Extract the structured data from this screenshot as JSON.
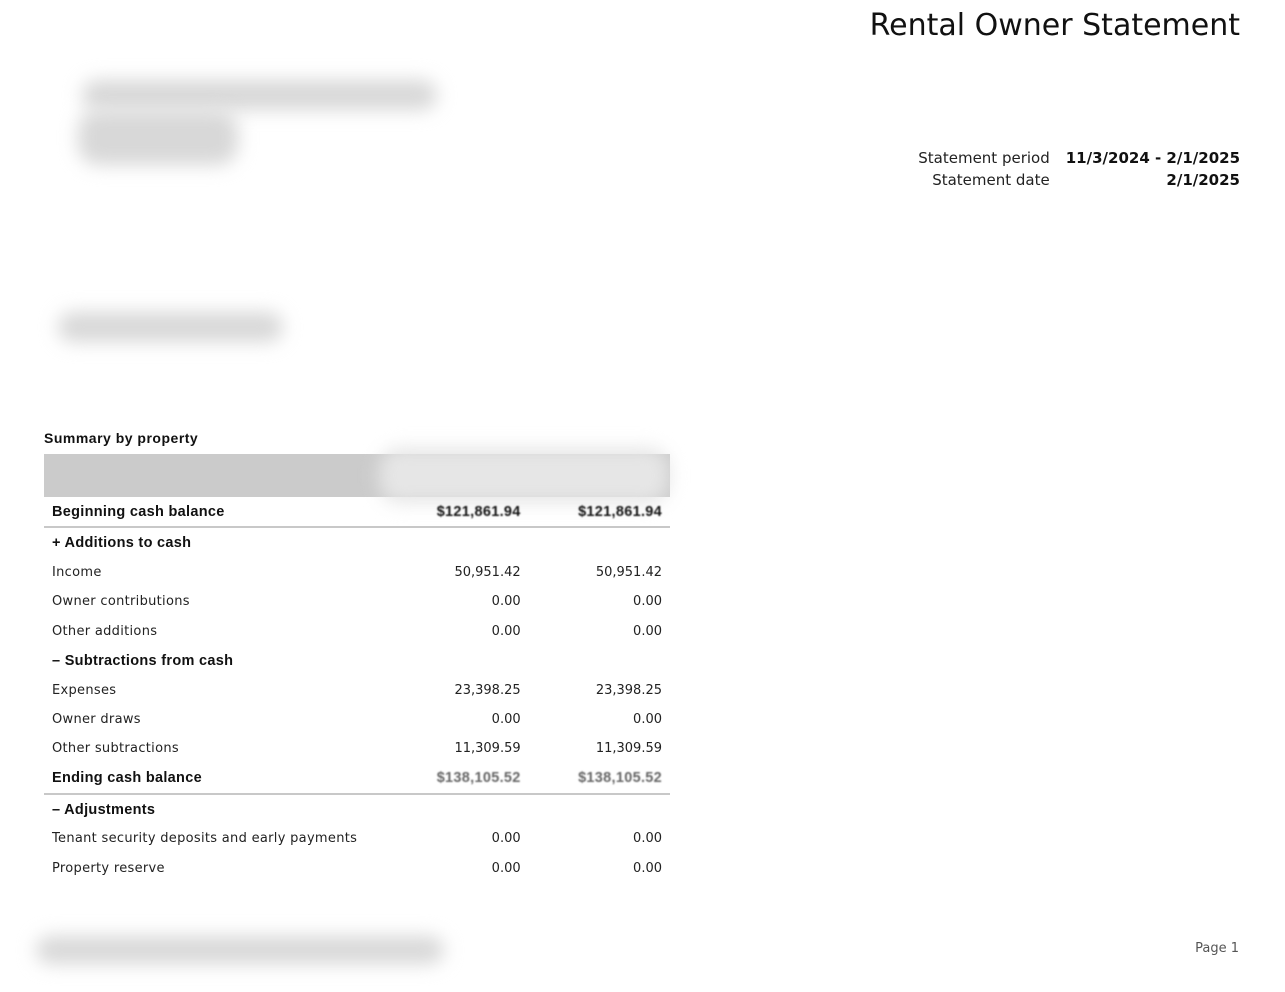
{
  "header": {
    "title": "Rental Owner Statement",
    "statement_period_label": "Statement period",
    "statement_period_value": "11/3/2024 - 2/1/2025",
    "statement_date_label": "Statement date",
    "statement_date_value": "2/1/2025"
  },
  "summary": {
    "title": "Summary by property",
    "rows": [
      {
        "label": "Beginning cash balance",
        "col1": "$121,861.94",
        "col2": "$121,861.94"
      },
      {
        "label": "+ Additions to cash",
        "col1": "",
        "col2": ""
      },
      {
        "label": "Income",
        "col1": "50,951.42",
        "col2": "50,951.42"
      },
      {
        "label": "Owner contributions",
        "col1": "0.00",
        "col2": "0.00"
      },
      {
        "label": "Other additions",
        "col1": "0.00",
        "col2": "0.00"
      },
      {
        "label": "– Subtractions from cash",
        "col1": "",
        "col2": ""
      },
      {
        "label": "Expenses",
        "col1": "23,398.25",
        "col2": "23,398.25"
      },
      {
        "label": "Owner draws",
        "col1": "0.00",
        "col2": "0.00"
      },
      {
        "label": "Other subtractions",
        "col1": "11,309.59",
        "col2": "11,309.59"
      },
      {
        "label": "Ending cash balance",
        "col1": "$138,105.52",
        "col2": "$138,105.52"
      },
      {
        "label": "– Adjustments",
        "col1": "",
        "col2": ""
      },
      {
        "label": "Tenant security deposits and early payments",
        "col1": "0.00",
        "col2": "0.00"
      },
      {
        "label": "Property reserve",
        "col1": "0.00",
        "col2": "0.00"
      }
    ]
  },
  "footer": {
    "page": "Page 1"
  }
}
